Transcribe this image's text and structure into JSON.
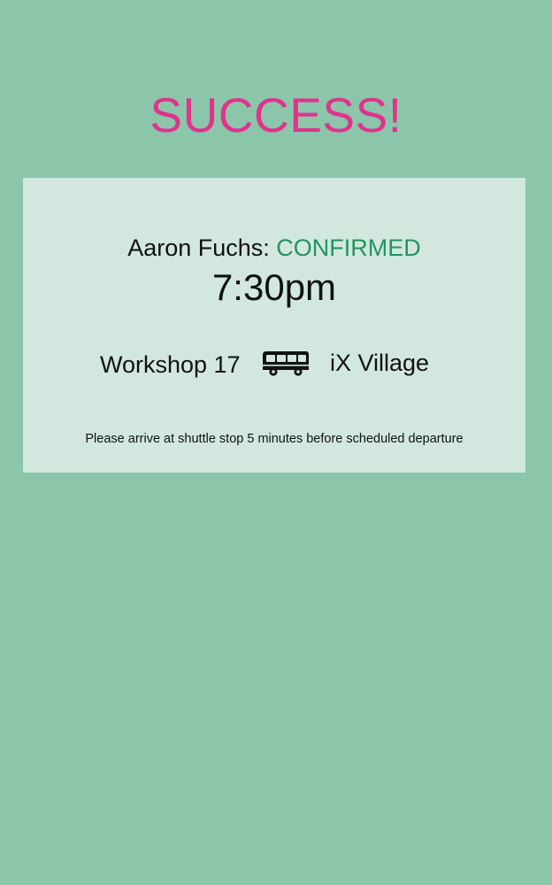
{
  "headline": "SUCCESS!",
  "booking": {
    "name_label": "Aaron Fuchs:",
    "status": "CONFIRMED",
    "time": "7:30pm",
    "origin": "Workshop 17",
    "destination": "iX Village",
    "transport_icon": "bus-icon",
    "note": "Please arrive at shuttle stop 5 minutes before scheduled departure"
  },
  "colors": {
    "background": "#8bc6ab",
    "card": "#d2e8df",
    "headline": "#e0338b",
    "status": "#21955c"
  }
}
